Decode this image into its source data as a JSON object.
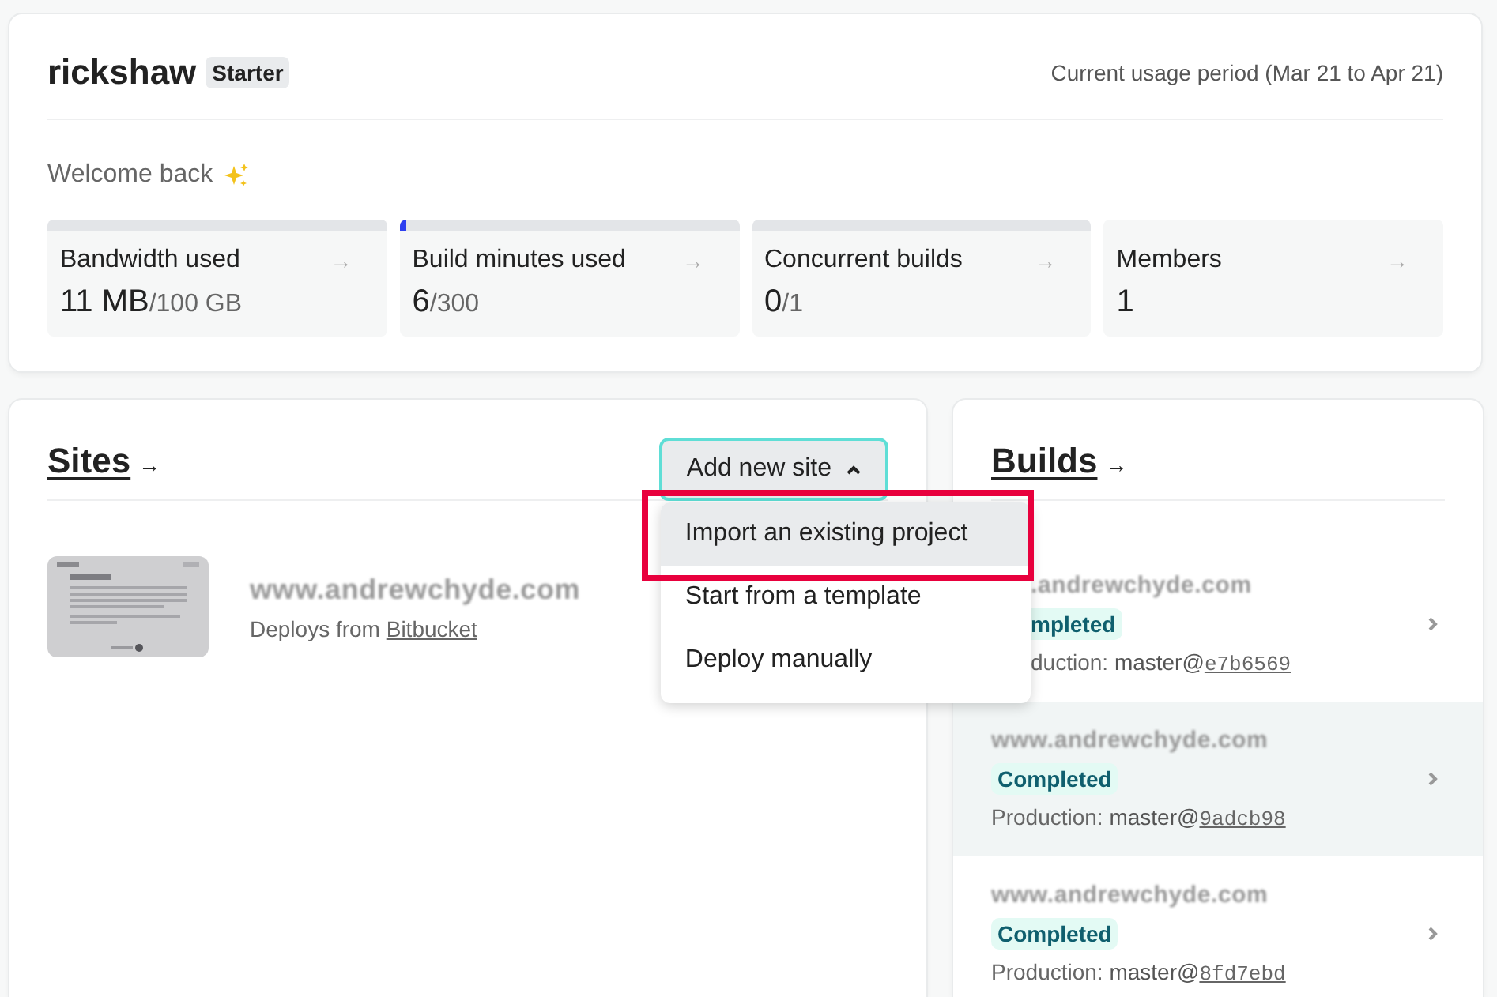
{
  "team": {
    "name": "rickshaw",
    "plan": "Starter",
    "usage_period": "Current usage period (Mar 21 to Apr 21)",
    "welcome": "Welcome back"
  },
  "usage_cards": [
    {
      "label": "Bandwidth used",
      "arrow": "→",
      "value": "11 MB",
      "limit": "/100 GB",
      "level": 0
    },
    {
      "label": "Build minutes used",
      "arrow": "→",
      "value": "6",
      "limit": "/300",
      "level": 0.02
    },
    {
      "label": "Concurrent builds",
      "arrow": "→",
      "value": "0",
      "limit": "/1",
      "level": 0
    },
    {
      "label": "Members",
      "arrow": "→",
      "value": "1"
    }
  ],
  "sites": {
    "title": "Sites",
    "arrow": "→",
    "add_button": "Add new site",
    "menu_expanded": true,
    "menu": [
      {
        "label": "Import an existing project",
        "highlighted": true
      },
      {
        "label": "Start from a template",
        "highlighted": false
      },
      {
        "label": "Deploy manually",
        "highlighted": false
      }
    ],
    "items": [
      {
        "domain": "www.andrewchyde.com",
        "deploys_label": "Deploys from",
        "provider": "Bitbucket"
      }
    ]
  },
  "builds": {
    "title": "Builds",
    "arrow": "→",
    "items": [
      {
        "domain": ".andrewchyde.com",
        "status": "mpleted",
        "context": "duction:",
        "branch": "master@",
        "commit": "e7b6569",
        "partly_hidden": true,
        "hovered": false
      },
      {
        "domain": "www.andrewchyde.com",
        "status": "Completed",
        "context": "Production:",
        "branch": "master@",
        "commit": "9adcb98",
        "partly_hidden": false,
        "hovered": true
      },
      {
        "domain": "www.andrewchyde.com",
        "status": "Completed",
        "context": "Production:",
        "branch": "master@",
        "commit": "8fd7ebd",
        "partly_hidden": false,
        "hovered": false
      }
    ]
  }
}
